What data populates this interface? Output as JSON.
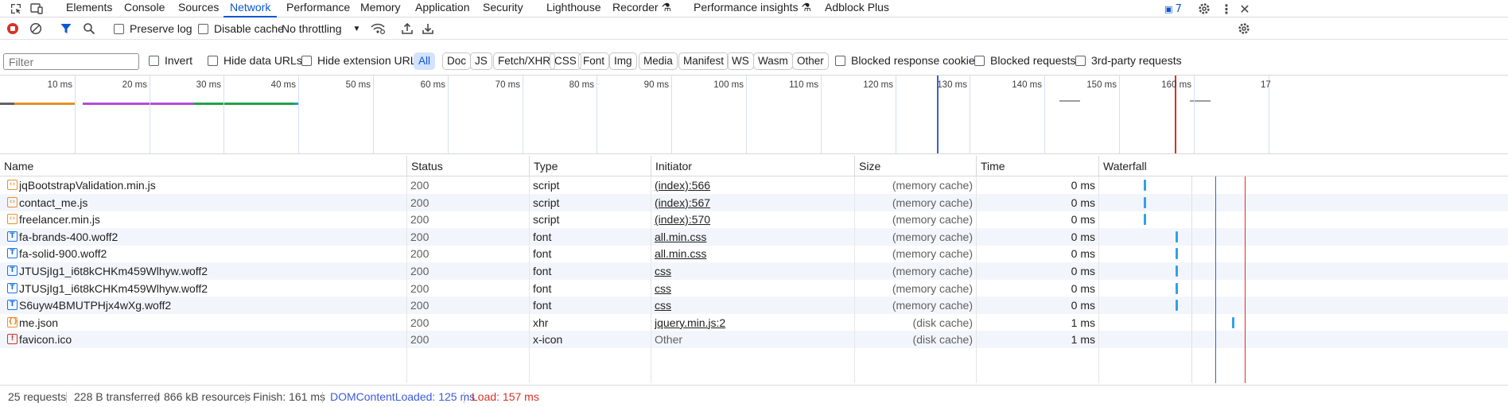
{
  "tabs": [
    {
      "label": "Elements",
      "active": false
    },
    {
      "label": "Console",
      "active": false
    },
    {
      "label": "Sources",
      "active": false
    },
    {
      "label": "Network",
      "active": true
    },
    {
      "label": "Performance",
      "active": false
    },
    {
      "label": "Memory",
      "active": false
    },
    {
      "label": "Application",
      "active": false
    },
    {
      "label": "Security",
      "active": false
    },
    {
      "label": "Lighthouse",
      "active": false
    },
    {
      "label": "Recorder",
      "active": false
    },
    {
      "label": "Performance insights",
      "active": false
    },
    {
      "label": "Adblock Plus",
      "active": false
    }
  ],
  "issues_count": "7",
  "toolbar": {
    "preserve_log": "Preserve log",
    "disable_cache": "Disable cache",
    "throttling": "No throttling"
  },
  "filter": {
    "placeholder": "Filter",
    "invert": "Invert",
    "hide_data_urls": "Hide data URLs",
    "hide_extension_urls": "Hide extension URLs",
    "types": [
      "All",
      "Doc",
      "JS",
      "Fetch/XHR",
      "CSS",
      "Font",
      "Img",
      "Media",
      "Manifest",
      "WS",
      "Wasm",
      "Other"
    ],
    "blocked_response_cookies": "Blocked response cookies",
    "blocked_requests": "Blocked requests",
    "third_party": "3rd-party requests"
  },
  "timeline": {
    "ticks": [
      "10 ms",
      "20 ms",
      "30 ms",
      "40 ms",
      "50 ms",
      "60 ms",
      "70 ms",
      "80 ms",
      "90 ms",
      "100 ms",
      "110 ms",
      "120 ms",
      "130 ms",
      "140 ms",
      "150 ms",
      "160 ms",
      "17"
    ],
    "dom_content_loaded_color": "#3b5bdb",
    "load_color": "#d93025"
  },
  "columns": [
    "Name",
    "Status",
    "Type",
    "Initiator",
    "Size",
    "Time",
    "Waterfall"
  ],
  "rows": [
    {
      "name": "jqBootstrapValidation.min.js",
      "icon": "script-icon",
      "status": "200",
      "type": "script",
      "initiator": "(index):566",
      "initiator_link": true,
      "size": "(memory cache)",
      "time": "0 ms"
    },
    {
      "name": "contact_me.js",
      "icon": "script-icon",
      "status": "200",
      "type": "script",
      "initiator": "(index):567",
      "initiator_link": true,
      "size": "(memory cache)",
      "time": "0 ms"
    },
    {
      "name": "freelancer.min.js",
      "icon": "script-icon",
      "status": "200",
      "type": "script",
      "initiator": "(index):570",
      "initiator_link": true,
      "size": "(memory cache)",
      "time": "0 ms"
    },
    {
      "name": "fa-brands-400.woff2",
      "icon": "font-icon",
      "status": "200",
      "type": "font",
      "initiator": "all.min.css",
      "initiator_link": true,
      "size": "(memory cache)",
      "time": "0 ms"
    },
    {
      "name": "fa-solid-900.woff2",
      "icon": "font-icon",
      "status": "200",
      "type": "font",
      "initiator": "all.min.css",
      "initiator_link": true,
      "size": "(memory cache)",
      "time": "0 ms"
    },
    {
      "name": "JTUSjIg1_i6t8kCHKm459Wlhyw.woff2",
      "icon": "font-icon",
      "status": "200",
      "type": "font",
      "initiator": "css",
      "initiator_link": true,
      "size": "(memory cache)",
      "time": "0 ms"
    },
    {
      "name": "JTUSjIg1_i6t8kCHKm459Wlhyw.woff2",
      "icon": "font-icon",
      "status": "200",
      "type": "font",
      "initiator": "css",
      "initiator_link": true,
      "size": "(memory cache)",
      "time": "0 ms"
    },
    {
      "name": "S6uyw4BMUTPHjx4wXg.woff2",
      "icon": "font-icon",
      "status": "200",
      "type": "font",
      "initiator": "css",
      "initiator_link": true,
      "size": "(memory cache)",
      "time": "0 ms"
    },
    {
      "name": "me.json",
      "icon": "xhr-icon",
      "status": "200",
      "type": "xhr",
      "initiator": "jquery.min.js:2",
      "initiator_link": true,
      "size": "(disk cache)",
      "time": "1 ms"
    },
    {
      "name": "favicon.ico",
      "icon": "image-icon",
      "status": "200",
      "type": "x-icon",
      "initiator": "Other",
      "initiator_link": false,
      "size": "(disk cache)",
      "time": "1 ms"
    }
  ],
  "status": {
    "requests": "25 requests",
    "transferred": "228 B transferred",
    "resources": "866 kB resources",
    "finish": "Finish: 161 ms",
    "dom_content_loaded": "DOMContentLoaded: 125 ms",
    "load": "Load: 157 ms"
  }
}
